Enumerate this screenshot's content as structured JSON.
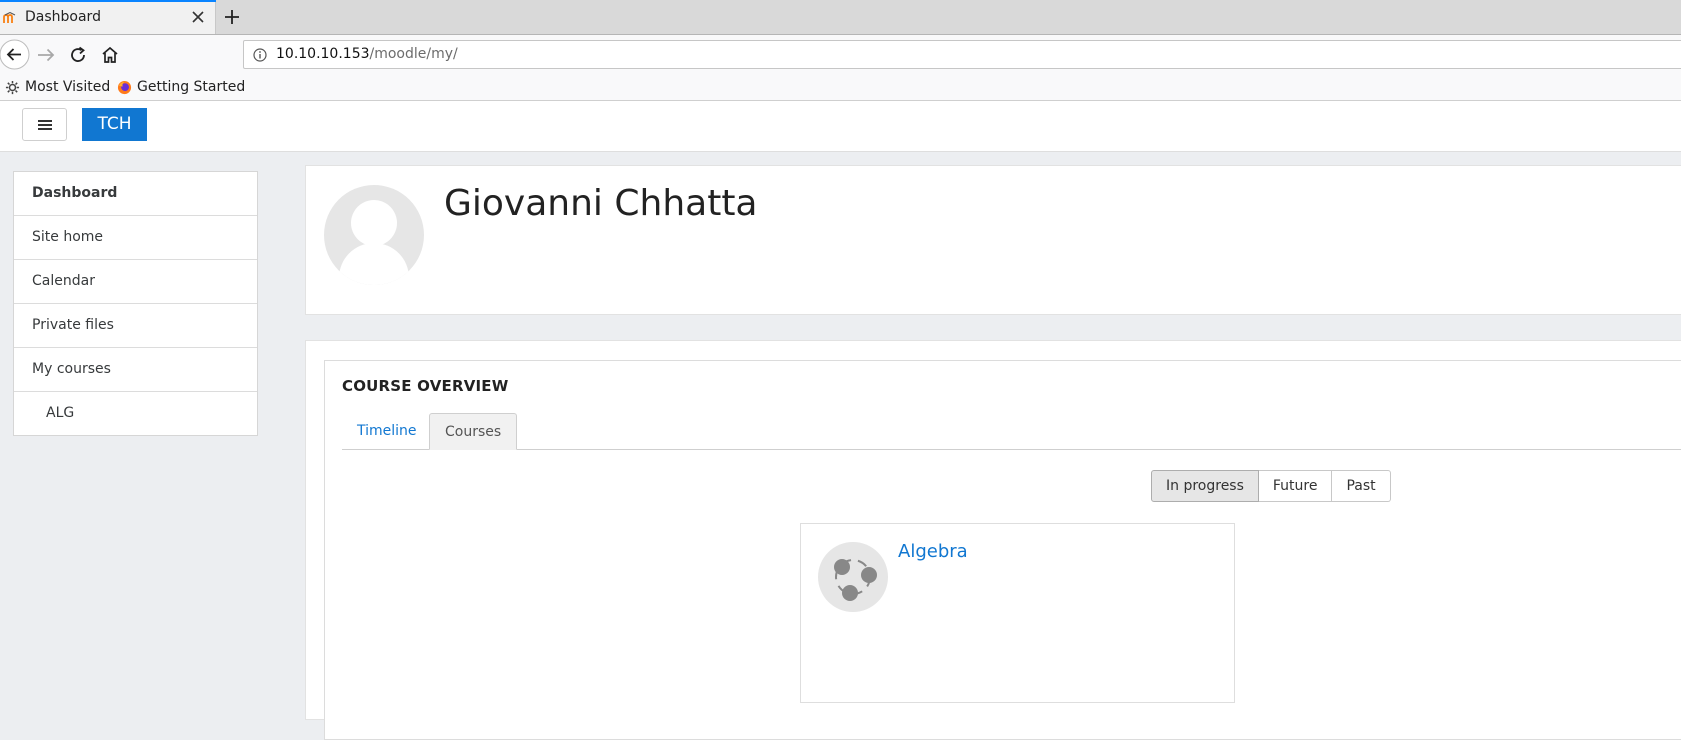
{
  "browser": {
    "tab_title": "Dashboard",
    "url_host": "10.10.10.153",
    "url_path": "/moodle/my/",
    "bookmarks": [
      {
        "label": "Most Visited",
        "icon": "gear-icon"
      },
      {
        "label": "Getting Started",
        "icon": "firefox-icon"
      }
    ]
  },
  "header": {
    "brand": "TCH"
  },
  "nav": {
    "items": [
      {
        "label": "Dashboard"
      },
      {
        "label": "Site home"
      },
      {
        "label": "Calendar"
      },
      {
        "label": "Private files"
      },
      {
        "label": "My courses"
      },
      {
        "label": "ALG"
      }
    ]
  },
  "profile": {
    "name": "Giovanni Chhatta"
  },
  "overview": {
    "title": "COURSE OVERVIEW",
    "tabs": [
      "Timeline",
      "Courses"
    ],
    "active_tab": "Courses",
    "filters": [
      "In progress",
      "Future",
      "Past"
    ],
    "selected_filter": "In progress",
    "courses": [
      {
        "name": "Algebra"
      }
    ]
  },
  "colors": {
    "accent": "#1177d1",
    "tab_indicator": "#0a84ff"
  }
}
